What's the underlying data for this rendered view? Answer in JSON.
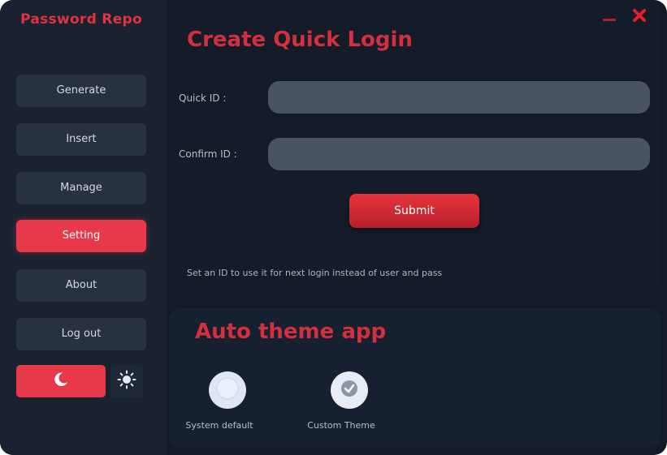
{
  "app": {
    "title": "Password Repo"
  },
  "window_controls": {
    "minimize_icon": "minimize-icon",
    "close_icon": "close-icon"
  },
  "sidebar": {
    "items": [
      {
        "label": "Generate"
      },
      {
        "label": "Insert"
      },
      {
        "label": "Manage"
      },
      {
        "label": "Setting",
        "active": true
      },
      {
        "label": "About"
      },
      {
        "label": "Log out"
      }
    ],
    "theme_toggle": {
      "dark_icon": "moon-icon",
      "light_icon": "sun-icon",
      "selected": "dark"
    }
  },
  "quick_login": {
    "title": "Create Quick Login",
    "quick_id_label": "Quick ID :",
    "quick_id_value": "",
    "confirm_id_label": "Confirm ID :",
    "confirm_id_value": "",
    "submit_label": "Submit",
    "hint": "Set an ID to use it for next login instead of user and pass"
  },
  "auto_theme": {
    "title": "Auto theme app",
    "options": [
      {
        "label": "System default",
        "icon": "circle-icon"
      },
      {
        "label": "Custom Theme",
        "icon": "check-icon"
      }
    ]
  },
  "colors": {
    "accent": "#e8394a",
    "title_red": "#d32f3c",
    "background": "#111a26",
    "sidebar": "#1a2230",
    "input": "#4a5364"
  }
}
